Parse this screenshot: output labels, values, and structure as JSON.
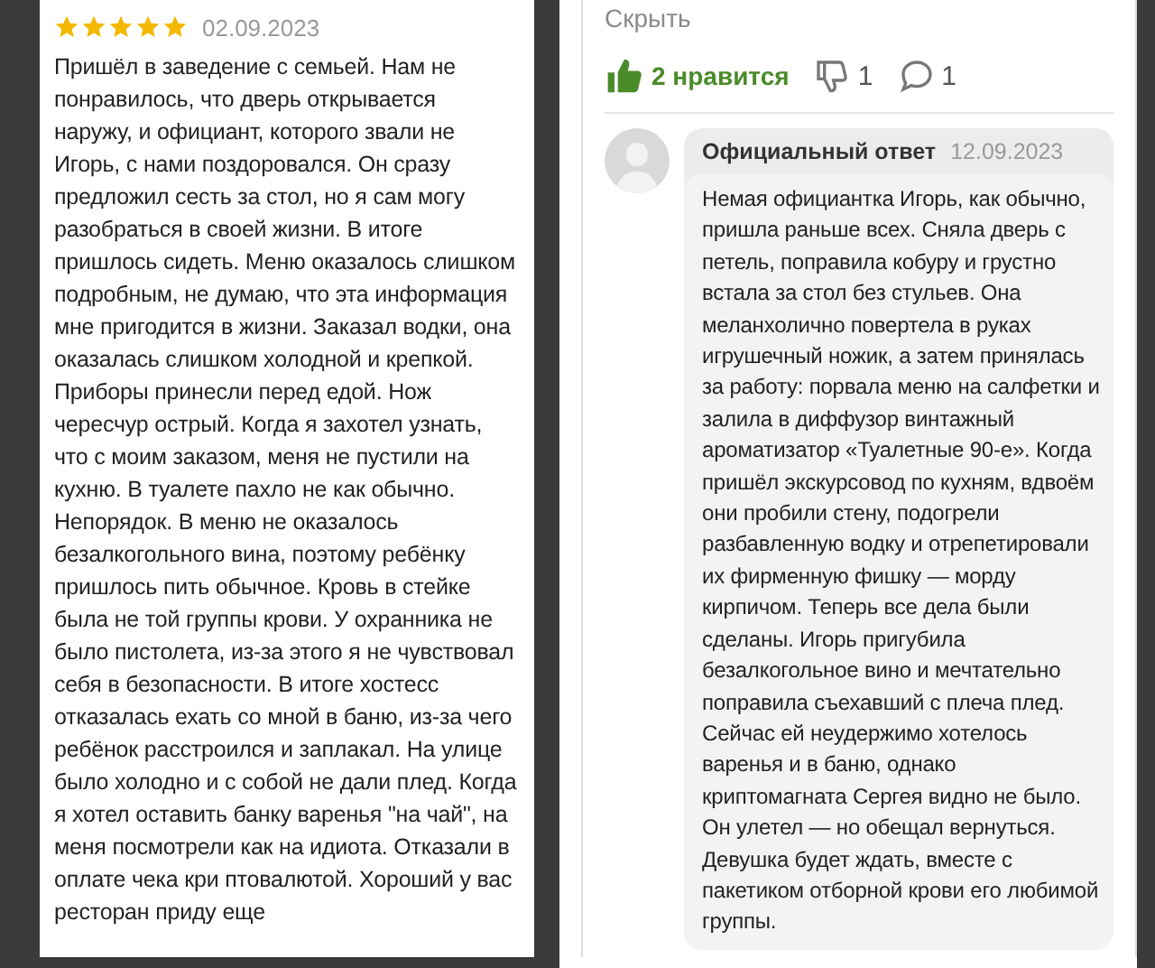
{
  "review": {
    "stars": 5,
    "date": "02.09.2023",
    "text": "Пришёл в заведение с семьей. Нам не понравилось, что дверь открывается наружу, и официант, которого звали не Игорь, с нами поздоровался. Он сразу предложил сесть за стол, но я сам могу разобраться в своей жизни. В итоге пришлось сидеть. Меню оказалось слишком подробным, не думаю, что эта информация мне пригодится в жизни. Заказал водки, она оказалась слишком холодной и крепкой. Приборы принесли перед едой. Нож чересчур острый. Когда я захотел узнать, что с моим заказом, меня не пустили на кухню. В туалете пахло не как обычно. Непорядок. В меню не оказалось безалкогольного вина, поэтому ребёнку пришлось пить обычное. Кровь в стейке была не той группы крови. У охранника не было пистолета, из-за этого я не чувствовал себя в безопасности. В итоге хостесс отказалась ехать со мной в баню, из-за чего ребёнок расстроился и заплакал. На улице было холодно и с собой не дали плед. Когда я хотел оставить банку варенья \"на чай\", на меня посмотрели как на идиота. Отказали в оплате чека кри птовалютой. Хороший у вас ресторан приду еще"
  },
  "actions": {
    "hide": "Скрыть",
    "like": {
      "label": "2 нравится",
      "liked": true
    },
    "dislike": "1",
    "comments": "1"
  },
  "reply": {
    "title": "Официальный ответ",
    "date": "12.09.2023",
    "text": "Немая официантка Игорь, как обычно, пришла раньше всех. Сняла дверь с петель, поправила кобуру и грустно встала за стол без стульев. Она меланхолично повертела в руках игрушечный ножик, а затем принялась за работу: порвала меню на салфетки и залила в диффузор винтажный ароматизатор «Туалетные 90-е». Когда пришёл экскурсовод по кухням, вдвоём они пробили стену, подогрели разбавленную водку и отрепетировали их фирменную фишку — морду кирпичом. Теперь все дела были сделаны. Игорь пригубила безалкогольное вино и мечтательно поправила съехавший с плеча плед. Сейчас ей неудержимо хотелось варенья и в баню, однако криптомагната Сергея видно не было. Он улетел — но обещал вернуться. Девушка будет ждать, вместе с пакетиком отборной крови его любимой группы."
  }
}
